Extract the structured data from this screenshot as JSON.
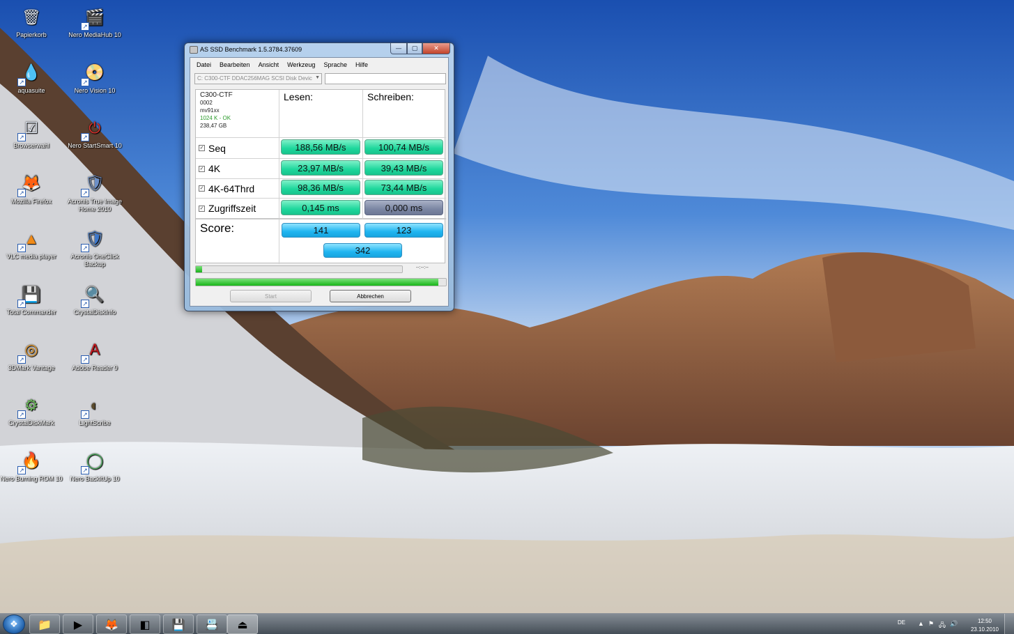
{
  "desktop": {
    "icons": [
      {
        "label": "Papierkorb",
        "icon": "recycle-bin-icon",
        "glyph": "🗑",
        "color": "#d7dde6"
      },
      {
        "label": "Nero MediaHub 10",
        "icon": "nero-mediahub-icon",
        "glyph": "🎬",
        "color": "#c94a2b"
      },
      {
        "label": "aquasuite",
        "icon": "aquasuite-icon",
        "glyph": "💧",
        "color": "#2e7ccf"
      },
      {
        "label": "Nero Vision 10",
        "icon": "nero-vision-icon",
        "glyph": "📀",
        "color": "#e26a3c"
      },
      {
        "label": "Browserwahl",
        "icon": "browserwahl-icon",
        "glyph": "☑",
        "color": "#e7eef8"
      },
      {
        "label": "Nero StartSmart 10",
        "icon": "nero-startsmart-icon",
        "glyph": "⏻",
        "color": "#d4302b"
      },
      {
        "label": "Mozilla Firefox",
        "icon": "firefox-icon",
        "glyph": "🦊",
        "color": "#e4771f"
      },
      {
        "label": "Acronis True Image Home 2010",
        "icon": "acronis-true-image-icon",
        "glyph": "🛡",
        "color": "#6c8fc7"
      },
      {
        "label": "VLC media player",
        "icon": "vlc-icon",
        "glyph": "▲",
        "color": "#f08a18"
      },
      {
        "label": "Acronis OneClick Backup",
        "icon": "acronis-oneclick-icon",
        "glyph": "🛡",
        "color": "#3f78c9"
      },
      {
        "label": "Total Commander",
        "icon": "total-commander-icon",
        "glyph": "💾",
        "color": "#233f8f"
      },
      {
        "label": "CrystalDiskInfo",
        "icon": "crystaldiskinfo-icon",
        "glyph": "🔍",
        "color": "#7b9bd5"
      },
      {
        "label": "3DMark Vantage",
        "icon": "3dmark-vantage-icon",
        "glyph": "◎",
        "color": "#e79a2d"
      },
      {
        "label": "Adobe Reader 9",
        "icon": "adobe-reader-icon",
        "glyph": "A",
        "color": "#c8161d"
      },
      {
        "label": "CrystalDiskMark",
        "icon": "crystaldiskmark-icon",
        "glyph": "⚙",
        "color": "#6ab35a"
      },
      {
        "label": "LightScribe",
        "icon": "lightscribe-icon",
        "glyph": "◐",
        "color": "#5a4a2b"
      },
      {
        "label": "Nero Burning ROM 10",
        "icon": "nero-burning-rom-icon",
        "glyph": "🔥",
        "color": "#c9402a"
      },
      {
        "label": "Nero BackItUp 10",
        "icon": "nero-backitup-icon",
        "glyph": "◯",
        "color": "#4aa85a"
      }
    ]
  },
  "window": {
    "title": "AS SSD Benchmark 1.5.3784.37609",
    "caption": {
      "min": "—",
      "max": "▢",
      "close": "✕"
    },
    "menu": [
      "Datei",
      "Bearbeiten",
      "Ansicht",
      "Werkzeug",
      "Sprache",
      "Hilfe"
    ],
    "drive_select": "C: C300-CTF DDAC256MAG SCSI Disk Devic",
    "drive_info": {
      "model": "C300-CTF",
      "firmware": "0002",
      "driver": "mv91xx",
      "alignment": "1024 K - OK",
      "size": "238,47 GB"
    },
    "headers": {
      "read": "Lesen:",
      "write": "Schreiben:"
    },
    "rows": [
      {
        "label": "Seq",
        "read": "188,56 MB/s",
        "write": "100,74 MB/s"
      },
      {
        "label": "4K",
        "read": "23,97 MB/s",
        "write": "39,43 MB/s"
      },
      {
        "label": "4K-64Thrd",
        "read": "98,36 MB/s",
        "write": "73,44 MB/s"
      },
      {
        "label": "Zugriffszeit",
        "read": "0,145 ms",
        "write": "0,000 ms"
      }
    ],
    "score": {
      "label": "Score:",
      "read": "141",
      "write": "123",
      "total": "342"
    },
    "progress_time": "--:--:--",
    "progress_top": 0.03,
    "progress_bottom": 0.97,
    "buttons": {
      "start": "Start",
      "abort": "Abbrechen"
    }
  },
  "taskbar": {
    "tray_lang": "DE",
    "time": "12:50",
    "date": "23.10.2010"
  }
}
